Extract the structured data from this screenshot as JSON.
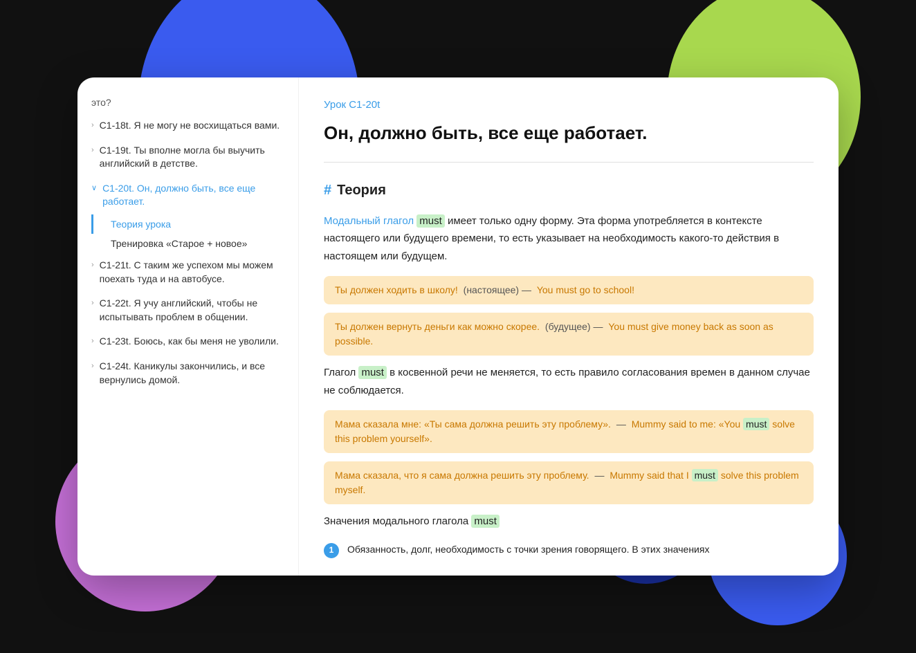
{
  "background": {
    "blobs": [
      "blue",
      "green",
      "purple",
      "blue2",
      "darkblue"
    ]
  },
  "sidebar": {
    "top_text": "это?",
    "items": [
      {
        "id": "c118",
        "label": "C1-18t. Я не могу не восхищаться вами.",
        "chevron": "›",
        "active": false
      },
      {
        "id": "c119",
        "label": "C1-19t. Ты вполне могла бы выучить английский в детстве.",
        "chevron": "›",
        "active": false
      },
      {
        "id": "c120",
        "label": "C1-20t. Он, должно быть, все еще работает.",
        "chevron": "∨",
        "active": true,
        "sub_items": [
          {
            "id": "theory",
            "label": "Теория урока",
            "active": true
          },
          {
            "id": "training",
            "label": "Тренировка «Старое + новое»",
            "active": false
          }
        ]
      },
      {
        "id": "c121",
        "label": "C1-21t. С таким же успехом мы можем поехать туда и на автобусе.",
        "chevron": "›",
        "active": false
      },
      {
        "id": "c122",
        "label": "C1-22t. Я учу английский, чтобы не испытывать проблем в общении.",
        "chevron": "›",
        "active": false
      },
      {
        "id": "c123",
        "label": "C1-23t. Боюсь, как бы меня не уволили.",
        "chevron": "›",
        "active": false
      },
      {
        "id": "c124",
        "label": "C1-24t. Каникулы закончились, и все вернулись домой.",
        "chevron": "›",
        "active": false
      }
    ]
  },
  "content": {
    "lesson_label": "Урок C1-20t",
    "lesson_title": "Он, должно быть, все еще работает.",
    "theory_heading": "Теория",
    "hash": "#",
    "paragraphs": {
      "p1_before": "Модальный глагол",
      "p1_must": "must",
      "p1_after": "имеет только одну форму. Эта форма употребляется в контексте настоящего или будущего времени, то есть указывает на необходимость какого-то действия в настоящем или будущем.",
      "ex1_ru": "Ты должен ходить в школу!",
      "ex1_mid": "(настоящее) —",
      "ex1_en": "You must go to school!",
      "ex2_ru": "Ты должен вернуть деньги как можно скорее.",
      "ex2_mid": "(будущее) —",
      "ex2_en": "You must give money back as soon as possible.",
      "p2_before": "Глагол",
      "p2_must": "must",
      "p2_after": "в косвенной речи не меняется, то есть правило согласования времен в данном случае не соблюдается.",
      "ex3_ru": "Мама сказала мне: «Ты сама должна решить эту проблему».",
      "ex3_dash": "—",
      "ex3_en_pre": "Mummy said to me: «You",
      "ex3_must": "must",
      "ex3_en_post": "solve this problem yourself».",
      "ex4_ru": "Мама сказала, что я сама должна решить эту проблему.",
      "ex4_dash": "—",
      "ex4_en_pre": "Mummy said that I",
      "ex4_must": "must",
      "ex4_en_post": "solve this problem myself.",
      "p3_before": "Значения модального глагола",
      "p3_must": "must",
      "meaning1_num": "1",
      "meaning1_text": "Обязанность, долг, необходимость с точки зрения говорящего. В этих значениях"
    }
  }
}
